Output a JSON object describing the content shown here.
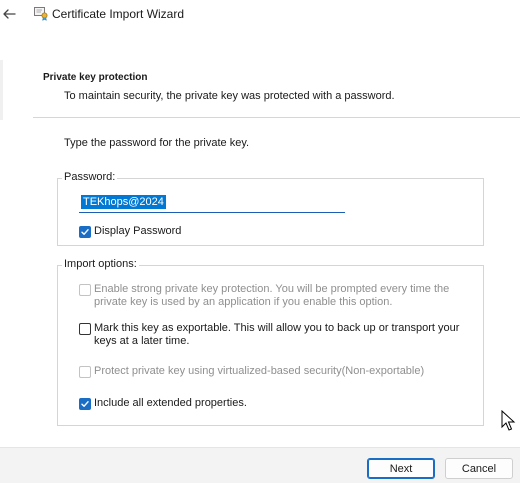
{
  "window": {
    "title": "Certificate Import Wizard",
    "icons": {
      "back": "back-arrow-icon",
      "app": "certificate-icon"
    }
  },
  "header": {
    "title": "Private key protection",
    "description": "To maintain security, the private key was protected with a password."
  },
  "instruction": "Type the password for the private key.",
  "password_group": {
    "legend": "Password:",
    "value": "TEKhops@2024",
    "display_password": {
      "label": "Display Password",
      "checked": true
    }
  },
  "import_options": {
    "legend": "Import options:",
    "options": [
      {
        "label": "Enable strong private key protection. You will be prompted every time the private key is used by an application if you enable this option.",
        "checked": false,
        "enabled": false
      },
      {
        "label": "Mark this key as exportable. This will allow you to back up or transport your keys at a later time.",
        "checked": false,
        "enabled": true
      },
      {
        "label": "Protect private key using virtualized-based security(Non-exportable)",
        "checked": false,
        "enabled": false
      },
      {
        "label": "Include all extended properties.",
        "checked": true,
        "enabled": true
      }
    ]
  },
  "footer": {
    "next_label": "Next",
    "cancel_label": "Cancel"
  },
  "colors": {
    "accent": "#1a6dc4",
    "selection": "#0078d4",
    "disabled_text": "#8f8f8f"
  }
}
